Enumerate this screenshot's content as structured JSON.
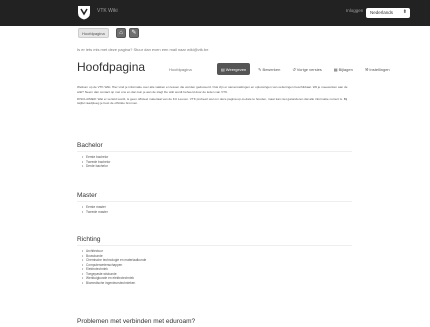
{
  "navbar": {
    "logo_icon": "vtk-shield-logo",
    "title": "VTK Wiki",
    "login_label": "Inloggen",
    "language": {
      "selected": "Nederlands"
    }
  },
  "toolbar": {
    "crumb_label": "Hoofdpagina",
    "buttons": [
      {
        "icon": "home-icon",
        "glyph": "⌂"
      },
      {
        "icon": "edit-icon",
        "glyph": "✎"
      }
    ]
  },
  "notice": "Is er iets mis met deze pagina? Stuur dan even een mail naar wiki@vtk.be",
  "page": {
    "title": "Hoofdpagina",
    "title_small": "Hoofdpagina",
    "tabs": [
      {
        "icon": "file-icon",
        "label": "Weergeven",
        "active": true
      },
      {
        "icon": "pencil-icon",
        "label": "Bewerken",
        "active": false
      },
      {
        "icon": "history-icon",
        "label": "Vorige versies",
        "active": false
      },
      {
        "icon": "file-text-icon",
        "label": "Bijlagen",
        "active": false
      },
      {
        "icon": "wrench-icon",
        "label": "Instellingen",
        "active": false
      }
    ],
    "intro": [
      "Welkom op de VTK Wiki. Hier vind je informatie over alle vakken en lessen die worden gedoceerd. Ook zijn er samenvattingen en oplossingen van oefeningen beschikbaar. Wil je meewerken aan de wiki? Neem dan contact op met ons en dan kun je aan de slag! De wiki wordt beheerd door de leden van VTK.",
      "DISCLAIMER: Wat er verteld wordt, is geen officieel materiaal van de KU Leuven. VTK probeert wel om deze pagina up-to-date te houden, maar kan niet garanderen dat alle informatie correct is. Bij twijfel raadpleeg je best de officiële bronnen."
    ],
    "sections": [
      {
        "title": "Bachelor",
        "items": [
          "Eerste bachelor",
          "Tweede bachelor",
          "Derde bachelor"
        ]
      },
      {
        "title": "Master",
        "items": [
          "Eerste master",
          "Tweede master"
        ]
      },
      {
        "title": "Richting",
        "items": [
          "Architectuur",
          "Bouwkunde",
          "Chemische technologie en materiaalkunde",
          "Computerwetenschappen",
          "Elektrotechniek",
          "Toegepaste wiskunde",
          "Werktuigkunde en elektrotechniek",
          "Biomedische ingenieurstechnieken"
        ]
      },
      {
        "title": "Problemen met verbinden met eduroam?",
        "items": []
      }
    ]
  }
}
